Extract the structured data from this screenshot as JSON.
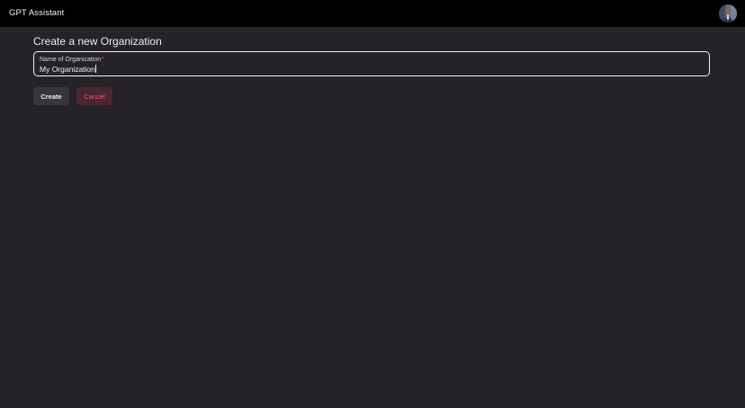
{
  "app": {
    "title": "GPT Assistant"
  },
  "user": {
    "avatar_icon": "user-avatar-icon"
  },
  "page": {
    "title": "Create a new Organization"
  },
  "form": {
    "name_field": {
      "label": "Name of Organization",
      "required_marker": "*",
      "value": "My Organization"
    },
    "create_label": "Create",
    "cancel_label": "Cancel"
  },
  "colors": {
    "background": "#252328",
    "topbar": "#000000",
    "required": "#e0556b",
    "cancel_text": "#e3566f",
    "cancel_bg": "#4a2633"
  }
}
